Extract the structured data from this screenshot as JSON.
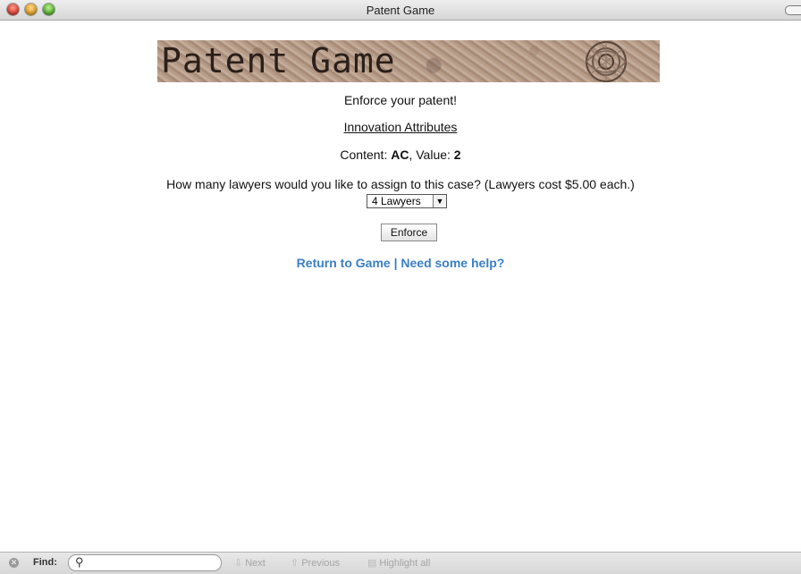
{
  "window": {
    "title": "Patent Game"
  },
  "banner": {
    "text": "Patent Game"
  },
  "page": {
    "heading": "Enforce your patent!",
    "attributes_link": "Innovation Attributes",
    "content_label": "Content: ",
    "content_value": "AC",
    "value_label": ", Value: ",
    "value_value": "2",
    "question": "How many lawyers would you like to assign to this case? (Lawyers cost $5.00 each.)",
    "lawyers_select": {
      "selected": "4 Lawyers"
    },
    "enforce_button": "Enforce",
    "return_link": "Return to Game",
    "separator": " | ",
    "help_link": "Need some help?"
  },
  "findbar": {
    "label": "Find:",
    "search_value": "",
    "next": "Next",
    "previous": "Previous",
    "highlight": "Highlight all"
  },
  "colors": {
    "link": "#3a7fc9"
  },
  "icons": [
    "close-icon",
    "search-icon",
    "arrow-down-icon",
    "arrow-up-icon",
    "highlight-icon"
  ]
}
